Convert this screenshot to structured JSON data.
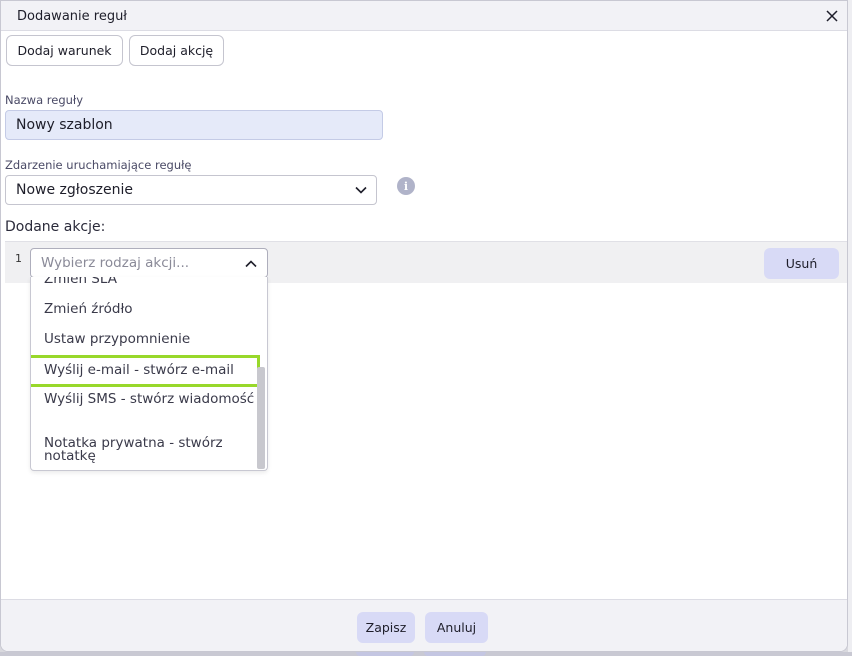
{
  "dialog": {
    "title": "Dodawanie reguł",
    "close_icon": "close-icon"
  },
  "toolbar": {
    "add_condition": "Dodaj warunek",
    "add_action": "Dodaj akcję"
  },
  "form": {
    "rule_name_label": "Nazwa reguły",
    "rule_name_value": "Nowy szablon",
    "trigger_label": "Zdarzenie uruchamiające regułę",
    "trigger_value": "Nowe zgłoszenie",
    "info_icon": "info-icon"
  },
  "actions": {
    "section_label": "Dodane akcje:",
    "rows": [
      {
        "number": "1",
        "select_placeholder": "Wybierz rodzaj akcji...",
        "remove_label": "Usuń"
      }
    ],
    "dropdown_options": [
      "Zmień SLA",
      "Zmień źródło",
      "Ustaw przypomnienie",
      "Wyślij e-mail - stwórz e-mail",
      "Wyślij SMS - stwórz wiadomość",
      "Notatka prywatna - stwórz notatkę"
    ],
    "highlighted_option": "Wyślij e-mail - stwórz e-mail",
    "highlight_color": "#98d82a"
  },
  "footer": {
    "save": "Zapisz",
    "cancel": "Anuluj"
  },
  "colors": {
    "accent_button": "#d8daf6",
    "input_fill": "#e5eaf9"
  }
}
